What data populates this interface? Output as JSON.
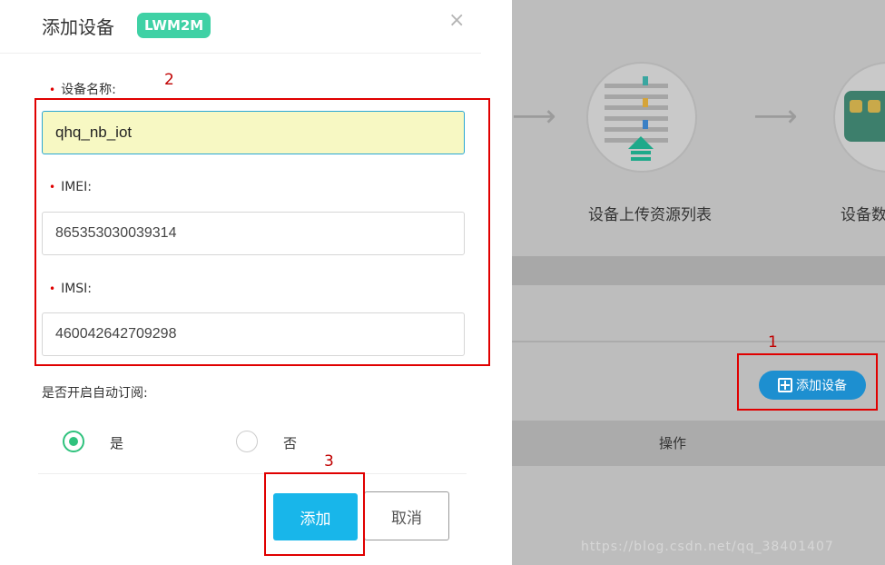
{
  "modal": {
    "title": "添加设备",
    "protocol_badge": "LWM2M",
    "close_glyph": "×",
    "fields": [
      {
        "label": "设备名称:",
        "value": "qhq_nb_iot",
        "required": true
      },
      {
        "label": "IMEI:",
        "value": "865353030039314",
        "required": true
      },
      {
        "label": "IMSI:",
        "value": "460042642709298",
        "required": true
      }
    ],
    "auto_subscribe": {
      "label": "是否开启自动订阅:",
      "options": [
        "是",
        "否"
      ],
      "selected": "是"
    },
    "buttons": {
      "confirm": "添加",
      "cancel": "取消"
    }
  },
  "background": {
    "flow_steps": [
      "设备上传资源列表",
      "设备数"
    ],
    "add_device_button": "添加设备",
    "table_header_action": "操作"
  },
  "annotations": [
    "1",
    "2",
    "3"
  ],
  "colors": {
    "badge": "#3fd1a5",
    "primary_button": "#18b6ea",
    "radio_selected": "#2fc27d",
    "annotation": "#e00000",
    "bg_button": "#1d8fd0"
  },
  "icons": [
    "close-icon",
    "plus-box-icon",
    "resource-list-icon",
    "device-data-icon",
    "arrow-right-icon"
  ],
  "watermark": "https://blog.csdn.net/qq_38401407"
}
